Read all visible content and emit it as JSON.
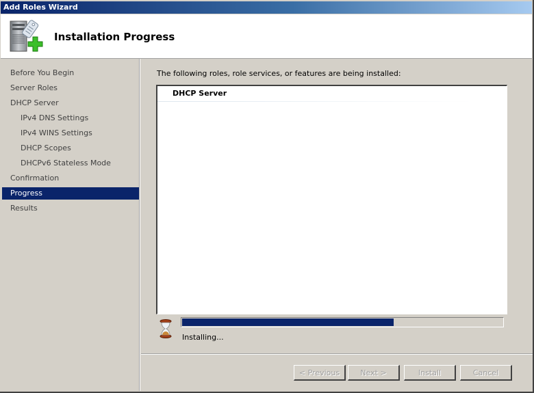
{
  "window": {
    "title": "Add Roles Wizard",
    "header_title": "Installation Progress",
    "header_icon": "server-add-role-icon"
  },
  "nav": {
    "items": [
      {
        "label": "Before You Begin",
        "level": 0,
        "active": false
      },
      {
        "label": "Server Roles",
        "level": 0,
        "active": false
      },
      {
        "label": "DHCP Server",
        "level": 0,
        "active": false
      },
      {
        "label": "IPv4 DNS Settings",
        "level": 1,
        "active": false
      },
      {
        "label": "IPv4 WINS Settings",
        "level": 1,
        "active": false
      },
      {
        "label": "DHCP Scopes",
        "level": 1,
        "active": false
      },
      {
        "label": "DHCPv6 Stateless Mode",
        "level": 1,
        "active": false
      },
      {
        "label": "Confirmation",
        "level": 0,
        "active": false
      },
      {
        "label": "Progress",
        "level": 0,
        "active": true
      },
      {
        "label": "Results",
        "level": 0,
        "active": false
      }
    ]
  },
  "content": {
    "intro": "The following roles, role services, or features are being installed:",
    "installing_items": [
      "DHCP Server"
    ],
    "progress_percent": 66,
    "status": "Installing...",
    "status_icon": "hourglass-icon"
  },
  "buttons": {
    "previous": "< Previous",
    "next": "Next >",
    "install": "Install",
    "cancel": "Cancel"
  },
  "colors": {
    "accent": "#0a246a",
    "window_bg": "#d4d0c8"
  }
}
